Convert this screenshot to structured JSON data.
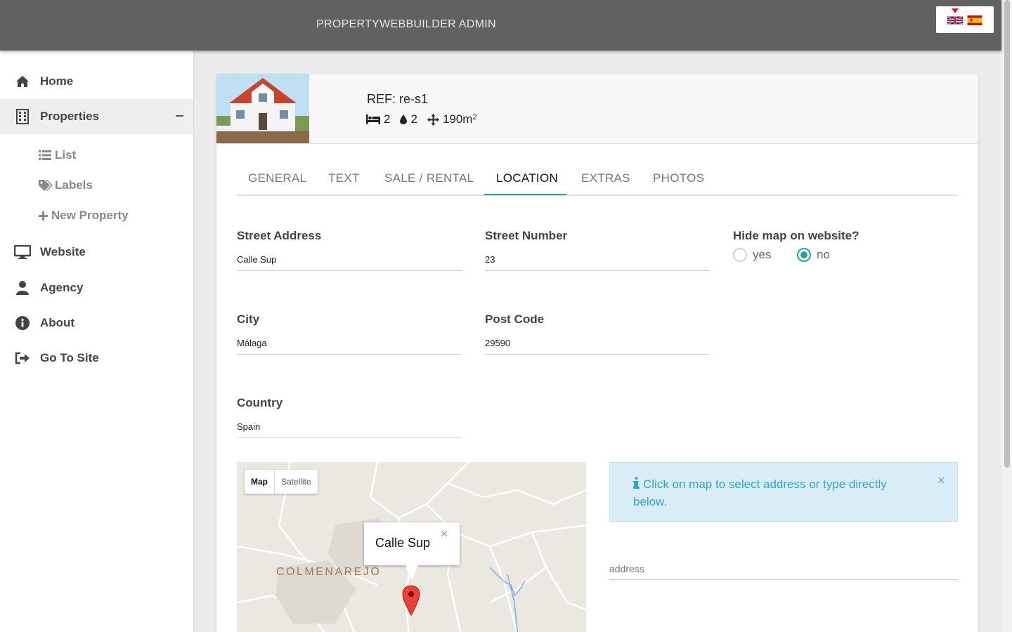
{
  "header": {
    "title": "PROPERTYWEBBUILDER ADMIN",
    "languages": [
      "en",
      "es"
    ]
  },
  "sidebar": {
    "items": [
      {
        "label": "Home",
        "icon": "home-icon"
      },
      {
        "label": "Properties",
        "icon": "building-icon",
        "expanded": true
      },
      {
        "label": "Website",
        "icon": "desktop-icon"
      },
      {
        "label": "Agency",
        "icon": "user-icon"
      },
      {
        "label": "About",
        "icon": "info-icon"
      },
      {
        "label": "Go To Site",
        "icon": "sign-out-icon"
      }
    ],
    "sub_items": [
      {
        "label": "List",
        "icon": "list-icon"
      },
      {
        "label": "Labels",
        "icon": "tags-icon"
      },
      {
        "label": "New Property",
        "icon": "plus-icon"
      }
    ]
  },
  "property": {
    "ref": "REF: re-s1",
    "bedrooms": "2",
    "bathrooms": "2",
    "area": "190m",
    "area_sup": "2"
  },
  "tabs": [
    "GENERAL",
    "TEXT",
    "SALE / RENTAL",
    "LOCATION",
    "EXTRAS",
    "PHOTOS"
  ],
  "active_tab": "LOCATION",
  "form": {
    "street_address": {
      "label": "Street Address",
      "value": "Calle Sup"
    },
    "street_number": {
      "label": "Street Number",
      "value": "23"
    },
    "hide_map": {
      "label": "Hide map on website?",
      "yes": "yes",
      "no": "no",
      "selected": "no"
    },
    "city": {
      "label": "City",
      "value": "Málaga"
    },
    "post_code": {
      "label": "Post Code",
      "value": "29590"
    },
    "country": {
      "label": "Country",
      "value": "Spain"
    }
  },
  "map": {
    "type_map": "Map",
    "type_satellite": "Satellite",
    "town_label": "COLMENAREJO",
    "info_window": "Calle Sup",
    "close": "×"
  },
  "alert": {
    "text": "Click on map to select address or type directly below.",
    "close": "×"
  },
  "address_input": {
    "placeholder": "address"
  },
  "colors": {
    "topbar": "#616161",
    "accent": "#26a69a",
    "alert_bg": "#d9edf7",
    "alert_text": "#31a4d6"
  }
}
